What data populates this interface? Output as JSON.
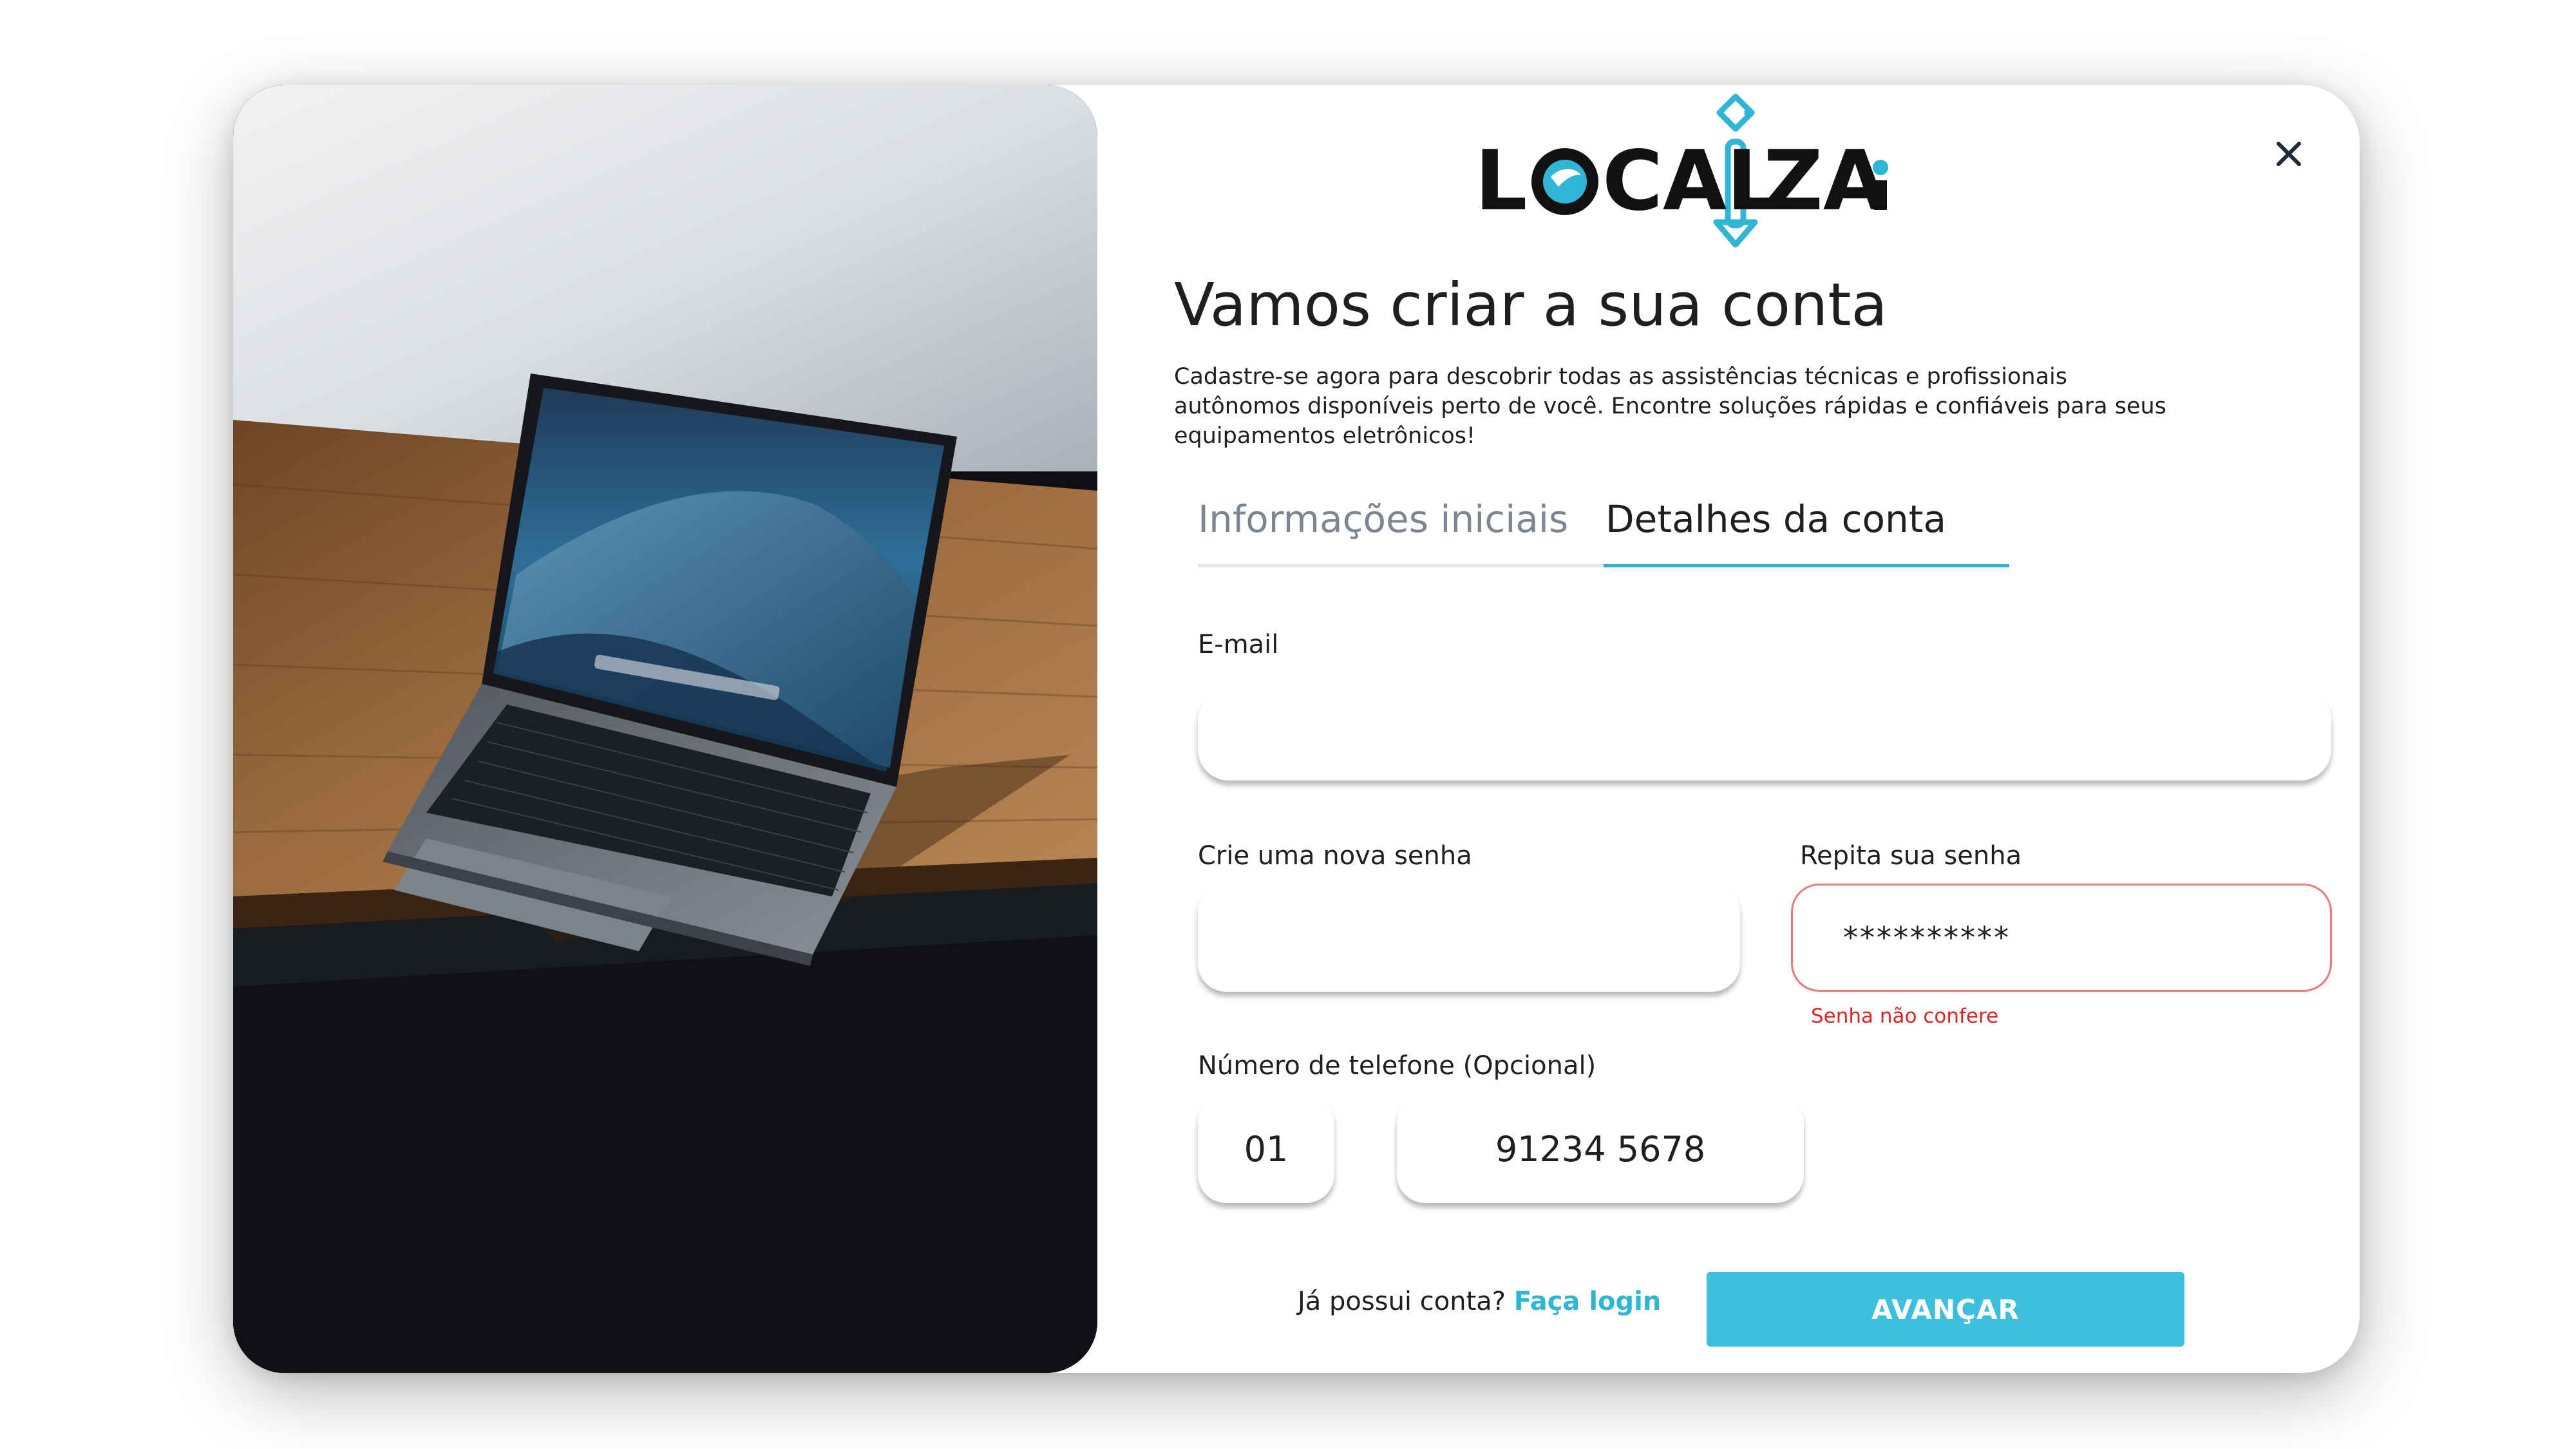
{
  "brand": {
    "logo_text": "LOCALIZAi",
    "accent_color": "#2fb6d6",
    "error_color": "#e02424"
  },
  "header": {
    "close_icon": "close-icon"
  },
  "form": {
    "title": "Vamos criar a sua conta",
    "subtitle": "Cadastre-se agora para descobrir todas as assistências técnicas e profissionais autônomos disponíveis perto de você. Encontre soluções rápidas e confiáveis para seus equipamentos eletrônicos!",
    "tabs": [
      {
        "label": "Informações iniciais",
        "active": false
      },
      {
        "label": "Detalhes da conta",
        "active": true
      }
    ],
    "email": {
      "label": "E-mail",
      "value": ""
    },
    "password": {
      "label": "Crie uma nova senha",
      "value": ""
    },
    "confirm_password": {
      "label": "Repita sua senha",
      "value": "**********",
      "error": "Senha não confere"
    },
    "phone": {
      "label": "Número de telefone (Opcional)",
      "area_code": "01",
      "number": "91234 5678"
    },
    "footer": {
      "login_prompt": "Já possui conta?",
      "login_link": "Faça login",
      "submit_label": "AVANÇAR"
    }
  }
}
